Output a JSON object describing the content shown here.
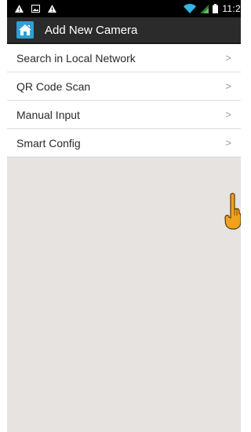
{
  "status_bar": {
    "time": "11:2",
    "left_icons": [
      "warning-icon",
      "image-icon",
      "warning-icon"
    ],
    "right_icons": [
      "wifi-icon",
      "signal-icon",
      "battery-icon"
    ]
  },
  "action_bar": {
    "title": "Add New Camera",
    "logo_icon": "home-camera-icon",
    "logo_color": "#2f9fd6"
  },
  "menu": {
    "items": [
      {
        "label": "Search in Local Network",
        "icon": "chevron-right-icon"
      },
      {
        "label": "QR Code Scan",
        "icon": "chevron-right-icon"
      },
      {
        "label": "Manual Input",
        "icon": "chevron-right-icon"
      },
      {
        "label": "Smart Config",
        "icon": "chevron-right-icon"
      }
    ]
  },
  "overlay": {
    "pointer_icon": "pointing-hand-icon",
    "pointer_color": "#f2a21a"
  },
  "colors": {
    "background": "#e6e3e0",
    "status_bar": "#000000",
    "action_bar": "#2b2b2b"
  }
}
